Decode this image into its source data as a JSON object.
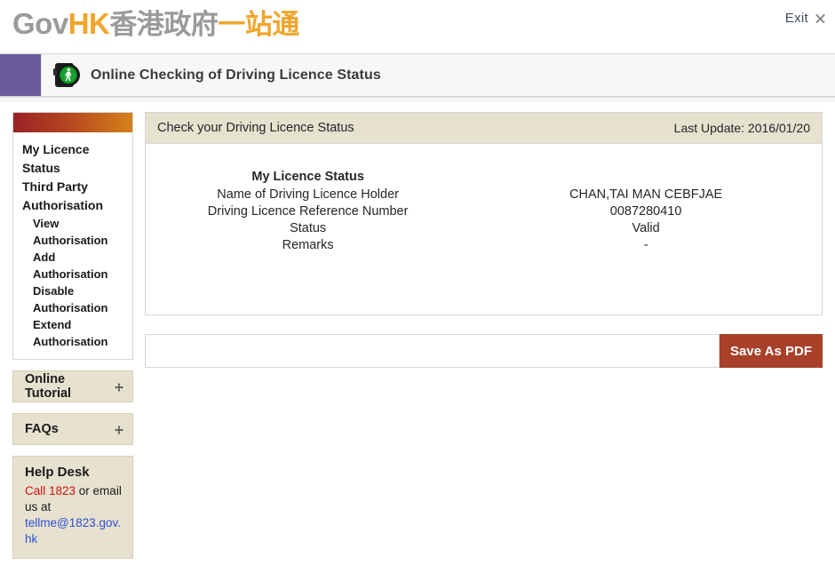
{
  "brand": {
    "logo_gov": "Gov",
    "logo_hk": "HK",
    "logo_cn_gray": "香港政府",
    "logo_cn_orange": "一站通",
    "exit_label": "Exit",
    "exit_icon": "close-icon"
  },
  "titlebar": {
    "title": "Online Checking of Driving Licence Status",
    "icon": "pedestrian-traffic-light-icon",
    "accent_color": "#6b5b9e"
  },
  "sidebar": {
    "nav_items": [
      {
        "label": "My Licence Status",
        "level": "top"
      },
      {
        "label": "Third Party Authorisation",
        "level": "top"
      },
      {
        "label": "View Authorisation",
        "level": "sub"
      },
      {
        "label": "Add Authorisation",
        "level": "sub"
      },
      {
        "label": "Disable Authorisation",
        "level": "sub"
      },
      {
        "label": "Extend Authorisation",
        "level": "sub"
      }
    ],
    "buttons": [
      {
        "label": "Online Tutorial",
        "icon": "expand-arrow-icon"
      },
      {
        "label": "FAQs",
        "icon": "expand-arrow-icon"
      }
    ],
    "help_desk": {
      "title": "Help Desk",
      "call_text": "Call 1823",
      "middle_text": " or email us at ",
      "email": "tellme@1823.gov.hk"
    }
  },
  "main": {
    "panel_title": "Check your Driving Licence Status",
    "last_update": "Last Update: 2016/01/20",
    "section_title": "My Licence Status",
    "rows": [
      {
        "label": "Name of Driving Licence Holder",
        "value": "CHAN,TAI MAN CEBFJAE"
      },
      {
        "label": "Driving Licence Reference Number",
        "value": "0087280410"
      },
      {
        "label": "Status",
        "value": "Valid"
      },
      {
        "label": "Remarks",
        "value": "-"
      }
    ],
    "save_pdf_label": "Save As PDF",
    "save_pdf_color": "#a8402a"
  }
}
